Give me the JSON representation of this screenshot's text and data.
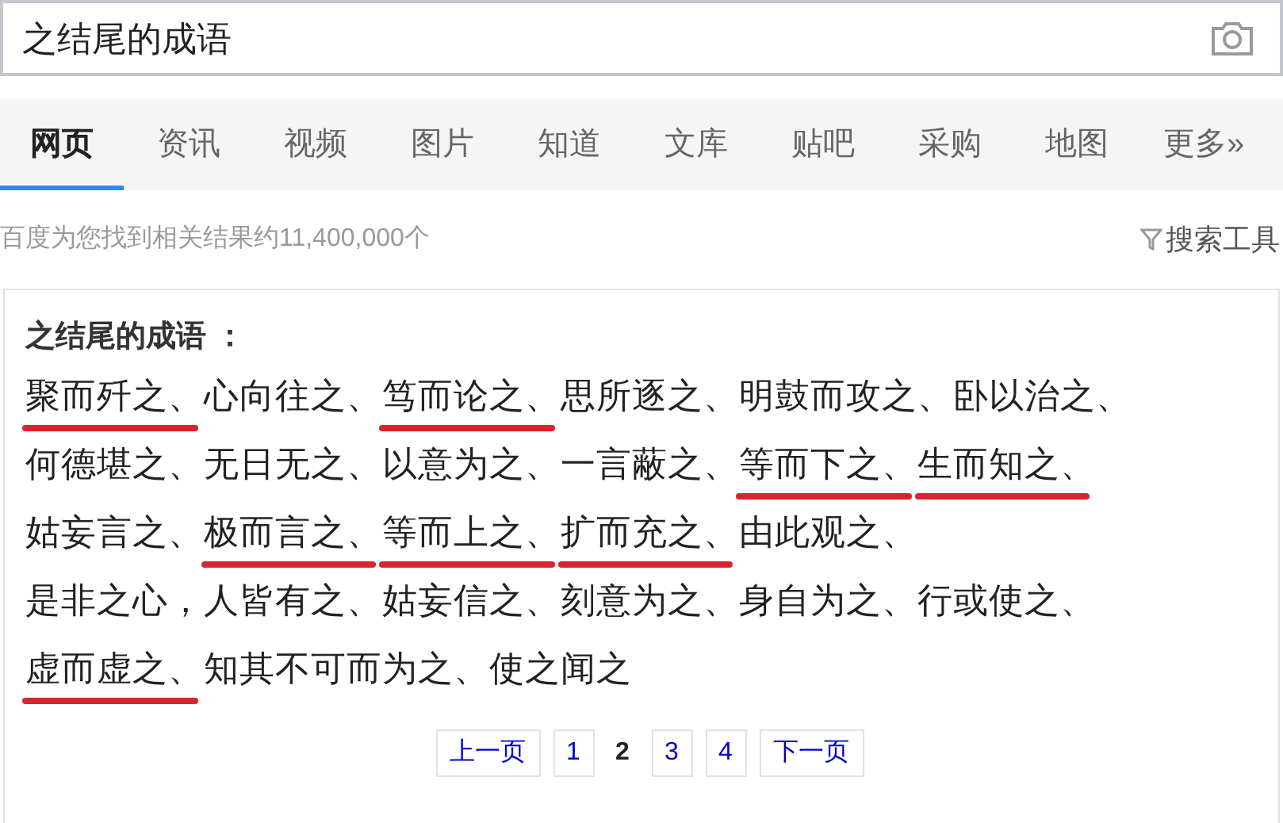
{
  "search": {
    "value": "之结尾的成语"
  },
  "tabs": [
    {
      "label": "网页",
      "selected": true
    },
    {
      "label": "资讯",
      "selected": false
    },
    {
      "label": "视频",
      "selected": false
    },
    {
      "label": "图片",
      "selected": false
    },
    {
      "label": "知道",
      "selected": false
    },
    {
      "label": "文库",
      "selected": false
    },
    {
      "label": "贴吧",
      "selected": false
    },
    {
      "label": "采购",
      "selected": false
    },
    {
      "label": "地图",
      "selected": false
    },
    {
      "label": "更多»",
      "selected": false
    }
  ],
  "result_count": "百度为您找到相关结果约11,400,000个",
  "search_tools": "搜索工具",
  "card": {
    "title": "之结尾的成语 ：",
    "lines": [
      [
        {
          "text": "聚而歼之、",
          "underlined": true
        },
        {
          "text": "心向往之、",
          "underlined": false
        },
        {
          "text": "笃而论之、",
          "underlined": true
        },
        {
          "text": "思所逐之、",
          "underlined": false
        },
        {
          "text": "明鼓而攻之、",
          "underlined": false
        },
        {
          "text": "卧以治之、",
          "underlined": false
        }
      ],
      [
        {
          "text": "何德堪之、",
          "underlined": false
        },
        {
          "text": "无日无之、",
          "underlined": false
        },
        {
          "text": "以意为之、",
          "underlined": false
        },
        {
          "text": "一言蔽之、",
          "underlined": false
        },
        {
          "text": "等而下之、",
          "underlined": true
        },
        {
          "text": "生而知之、",
          "underlined": true
        }
      ],
      [
        {
          "text": "姑妄言之、",
          "underlined": false
        },
        {
          "text": "极而言之、",
          "underlined": true
        },
        {
          "text": "等而上之、",
          "underlined": true
        },
        {
          "text": "扩而充之、",
          "underlined": true
        },
        {
          "text": "由此观之、",
          "underlined": false
        }
      ],
      [
        {
          "text": "是非之心，人皆有之、",
          "underlined": false
        },
        {
          "text": "姑妄信之、",
          "underlined": false
        },
        {
          "text": "刻意为之、",
          "underlined": false
        },
        {
          "text": "身自为之、",
          "underlined": false
        },
        {
          "text": "行或使之、",
          "underlined": false
        }
      ],
      [
        {
          "text": "虚而虚之、",
          "underlined": true
        },
        {
          "text": "知其不可而为之、",
          "underlined": false
        },
        {
          "text": "使之闻之",
          "underlined": false
        }
      ]
    ],
    "pagination": {
      "previous": "上一页",
      "pages": [
        {
          "label": "1",
          "selected": false
        },
        {
          "label": "2",
          "selected": true
        },
        {
          "label": "3",
          "selected": false
        },
        {
          "label": "4",
          "selected": false
        }
      ],
      "next": "下一页"
    }
  }
}
